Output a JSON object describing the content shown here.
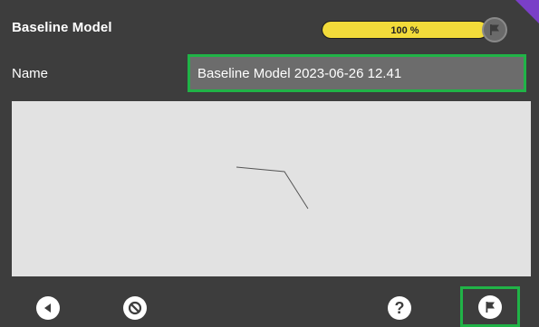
{
  "header": {
    "title": "Baseline Model",
    "progress": {
      "value": 1.0,
      "label": "100 %",
      "fill_color": "#f2db3a",
      "flag_icon": "flag-icon"
    }
  },
  "form": {
    "name_label": "Name",
    "name_value": "Baseline Model 2023-06-26 12.41",
    "highlight_color": "#20b347"
  },
  "canvas": {
    "background": "#e2e2e2"
  },
  "toolbar": {
    "back_icon": "back-arrow-icon",
    "cancel_icon": "cancel-icon",
    "help_icon": "help-icon",
    "help_glyph": "?",
    "finish_icon": "flag-icon"
  }
}
